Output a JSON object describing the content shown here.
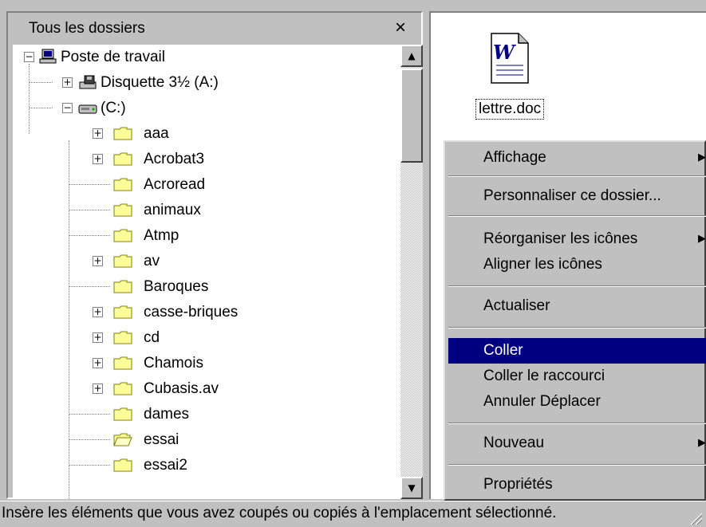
{
  "folder_pane": {
    "title": "Tous les dossiers",
    "close_label": "×"
  },
  "tree": {
    "items": [
      {
        "label": "Poste de travail",
        "icon": "computer-icon",
        "expander": "minus"
      },
      {
        "label": "Disquette 3½ (A:)",
        "icon": "floppy-drive-icon",
        "expander": "plus"
      },
      {
        "label": "(C:)",
        "icon": "hard-drive-icon",
        "expander": "minus"
      },
      {
        "label": "aaa",
        "icon": "folder-icon",
        "expander": "plus"
      },
      {
        "label": "Acrobat3",
        "icon": "folder-icon",
        "expander": "plus"
      },
      {
        "label": "Acroread",
        "icon": "folder-icon",
        "expander": ""
      },
      {
        "label": "animaux",
        "icon": "folder-icon",
        "expander": ""
      },
      {
        "label": "Atmp",
        "icon": "folder-icon",
        "expander": ""
      },
      {
        "label": "av",
        "icon": "folder-icon",
        "expander": "plus"
      },
      {
        "label": "Baroques",
        "icon": "folder-icon",
        "expander": ""
      },
      {
        "label": "casse-briques",
        "icon": "folder-icon",
        "expander": "plus"
      },
      {
        "label": "cd",
        "icon": "folder-icon",
        "expander": "plus"
      },
      {
        "label": "Chamois",
        "icon": "folder-icon",
        "expander": "plus"
      },
      {
        "label": "Cubasis.av",
        "icon": "folder-icon",
        "expander": "plus"
      },
      {
        "label": "dames",
        "icon": "folder-icon",
        "expander": ""
      },
      {
        "label": "essai",
        "icon": "open-folder-icon",
        "expander": ""
      },
      {
        "label": "essai2",
        "icon": "folder-icon",
        "expander": ""
      }
    ]
  },
  "file": {
    "name": "lettre.doc",
    "icon": "word-document-icon"
  },
  "context_menu": {
    "items": [
      {
        "label": "Affichage",
        "submenu": "▶"
      },
      {
        "label": "Personnaliser ce dossier..."
      },
      {
        "label": "Réorganiser les icônes",
        "submenu": "▶"
      },
      {
        "label": "Aligner les icônes"
      },
      {
        "label": "Actualiser"
      },
      {
        "label": "Coller",
        "highlighted": true
      },
      {
        "label": "Coller le raccourci"
      },
      {
        "label": "Annuler Déplacer"
      },
      {
        "label": "Nouveau",
        "submenu": "▶"
      },
      {
        "label": "Propriétés"
      }
    ]
  },
  "status_bar": {
    "text": "Insère les éléments que vous avez coupés ou copiés à l'emplacement sélectionné."
  },
  "scrollbar": {
    "up_arrow": "▲",
    "down_arrow": "▼"
  },
  "colors": {
    "highlight": "#000080",
    "face": "#c0c0c0",
    "folder": "#ffff99"
  }
}
